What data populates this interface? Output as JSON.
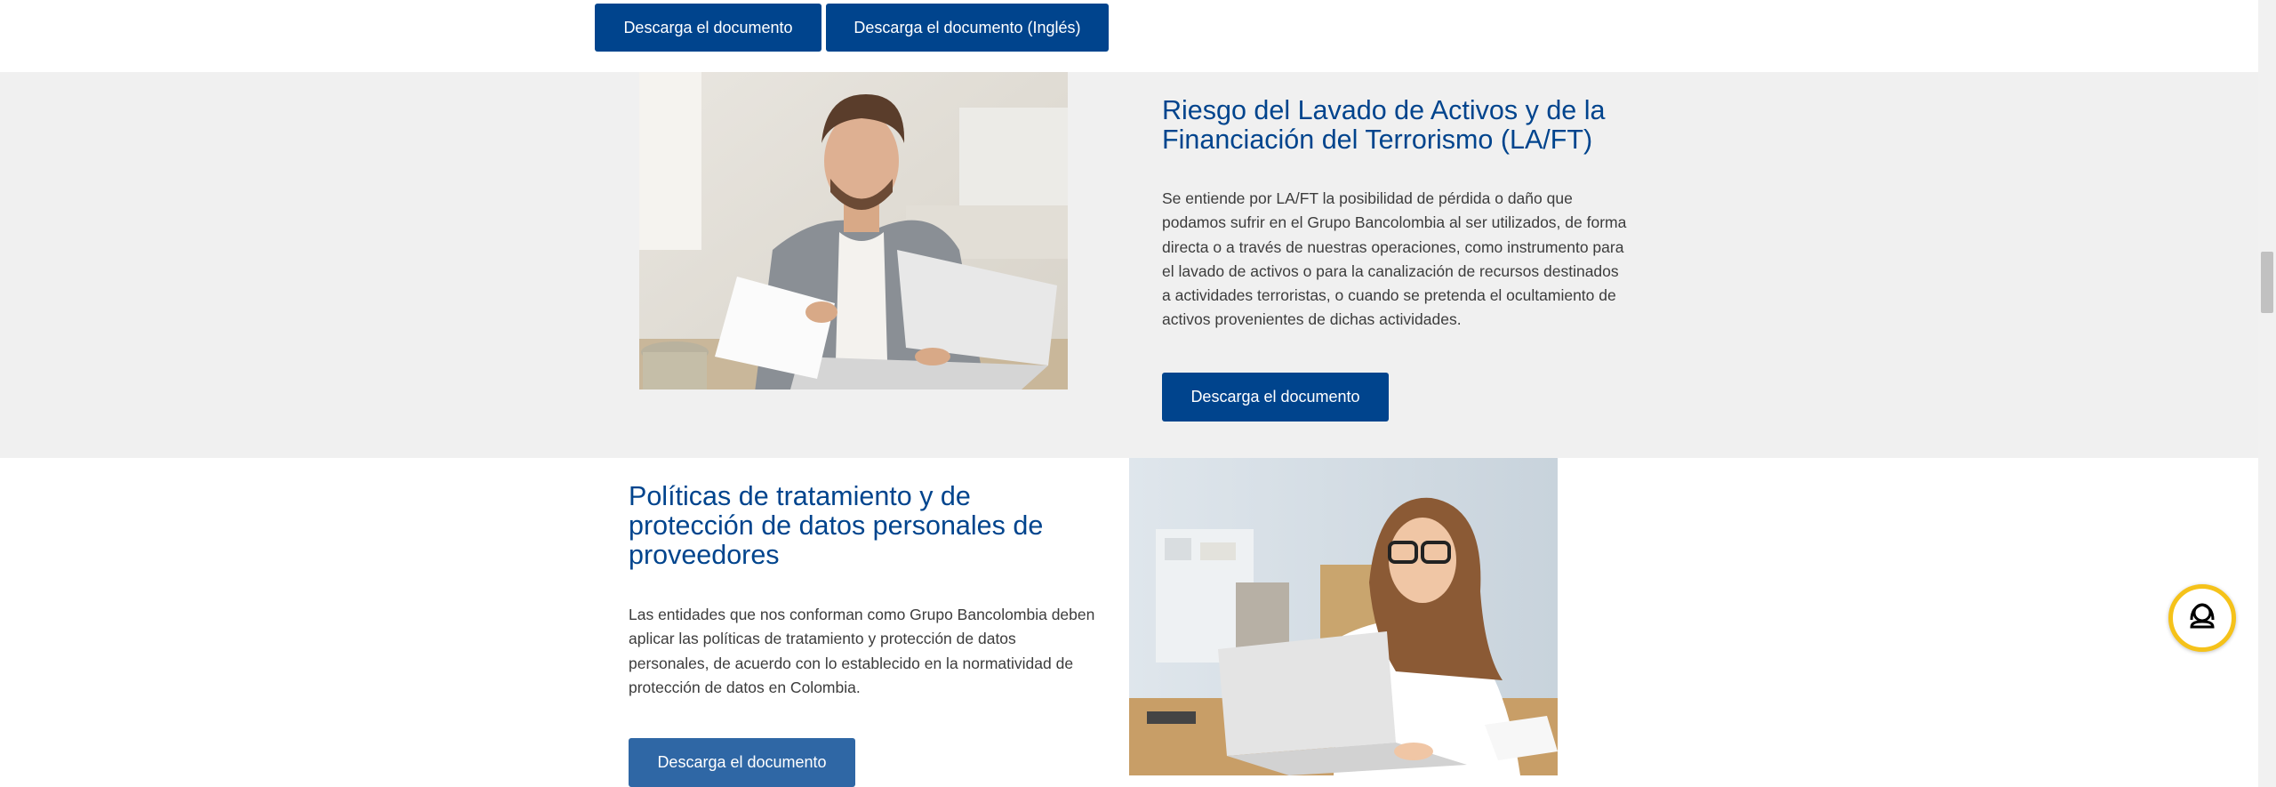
{
  "top_buttons": {
    "download_label": "Descarga el documento",
    "download_english_label": "Descarga el documento (Inglés)"
  },
  "laft": {
    "title_line1": "Riesgo del Lavado de Activos y de la",
    "title_line2": "Financiación del Terrorismo (LA/FT)",
    "body_lines": [
      "Se entiende por LA/FT la posibilidad de pérdida o daño que",
      "podamos sufrir en el Grupo Bancolombia al ser utilizados, de forma",
      "directa o a través de nuestras operaciones, como instrumento para",
      "el lavado de activos o para la canalización de recursos destinados",
      "a actividades terroristas, o cuando se pretenda el ocultamiento de",
      "activos provenientes de dichas actividades."
    ],
    "download_label": "Descarga el documento"
  },
  "privacy": {
    "title_lines": [
      "Políticas de tratamiento y de",
      "protección de datos personales de",
      "proveedores"
    ],
    "body_lines": [
      "Las entidades que nos conforman como Grupo Bancolombia deben",
      "aplicar las políticas de tratamiento y protección de datos",
      "personales, de acuerdo con lo establecido en la normatividad de",
      "protección de datos en Colombia."
    ],
    "download_label": "Descarga el documento"
  },
  "colors": {
    "brand_blue": "#00448d",
    "button_light_blue": "#2f67a5",
    "section_gray": "#f0f0f0",
    "chat_ring_yellow": "#f5c21a"
  },
  "icons": {
    "chat": "headset-chat-icon"
  }
}
